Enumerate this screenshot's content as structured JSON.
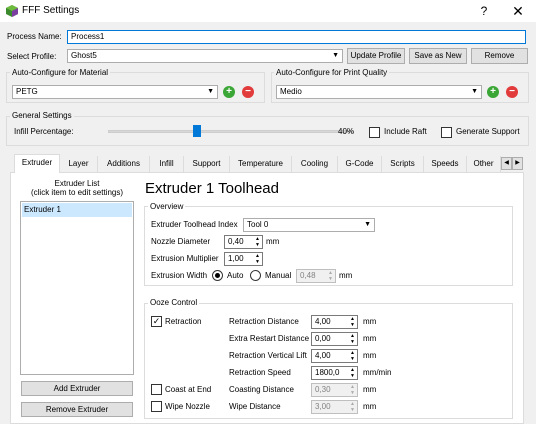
{
  "window": {
    "title": "FFF Settings",
    "help_glyph": "?",
    "close_glyph": "✕"
  },
  "process": {
    "name_label": "Process Name:",
    "name_value": "Process1"
  },
  "profile": {
    "label": "Select Profile:",
    "value": "Ghost5",
    "update_label": "Update Profile",
    "save_as_label": "Save as New",
    "remove_label": "Remove"
  },
  "material": {
    "title": "Auto-Configure for Material",
    "value": "PETG"
  },
  "quality": {
    "title": "Auto-Configure for Print Quality",
    "value": "Medio"
  },
  "general": {
    "title": "General Settings",
    "infill_label": "Infill Percentage:",
    "infill_value_text": "40%",
    "infill_fraction": 0.4,
    "raft_label": "Include Raft",
    "support_label": "Generate Support"
  },
  "tabs": [
    {
      "label": "Extruder"
    },
    {
      "label": "Layer"
    },
    {
      "label": "Additions"
    },
    {
      "label": "Infill"
    },
    {
      "label": "Support"
    },
    {
      "label": "Temperature"
    },
    {
      "label": "Cooling"
    },
    {
      "label": "G-Code"
    },
    {
      "label": "Scripts"
    },
    {
      "label": "Speeds"
    },
    {
      "label": "Other"
    }
  ],
  "extruder_list": {
    "title_line1": "Extruder List",
    "title_line2": "(click item to edit settings)",
    "items": [
      "Extruder 1"
    ],
    "add_label": "Add Extruder",
    "remove_label": "Remove Extruder"
  },
  "toolhead": {
    "heading": "Extruder 1 Toolhead",
    "overview_title": "Overview",
    "index_label": "Extruder Toolhead Index",
    "index_value": "Tool 0",
    "nozzle_label": "Nozzle Diameter",
    "nozzle_value": "0,40",
    "nozzle_unit": "mm",
    "multiplier_label": "Extrusion Multiplier",
    "multiplier_value": "1,00",
    "width_label": "Extrusion Width",
    "width_auto": "Auto",
    "width_manual": "Manual",
    "width_value": "0,48",
    "width_unit": "mm"
  },
  "ooze": {
    "title": "Ooze Control",
    "retraction_label": "Retraction",
    "coast_label": "Coast at End",
    "wipe_label": "Wipe Nozzle",
    "rows": [
      {
        "label": "Retraction Distance",
        "value": "4,00",
        "unit": "mm"
      },
      {
        "label": "Extra Restart Distance",
        "value": "0,00",
        "unit": "mm"
      },
      {
        "label": "Retraction Vertical Lift",
        "value": "4,00",
        "unit": "mm"
      },
      {
        "label": "Retraction Speed",
        "value": "1800,0",
        "unit": "mm/min"
      },
      {
        "label": "Coasting Distance",
        "value": "0,30",
        "unit": "mm"
      },
      {
        "label": "Wipe Distance",
        "value": "3,00",
        "unit": "mm"
      }
    ]
  },
  "colors": {
    "accent": "#0078d7",
    "add": "#3aa635",
    "delete": "#e23b3b"
  }
}
